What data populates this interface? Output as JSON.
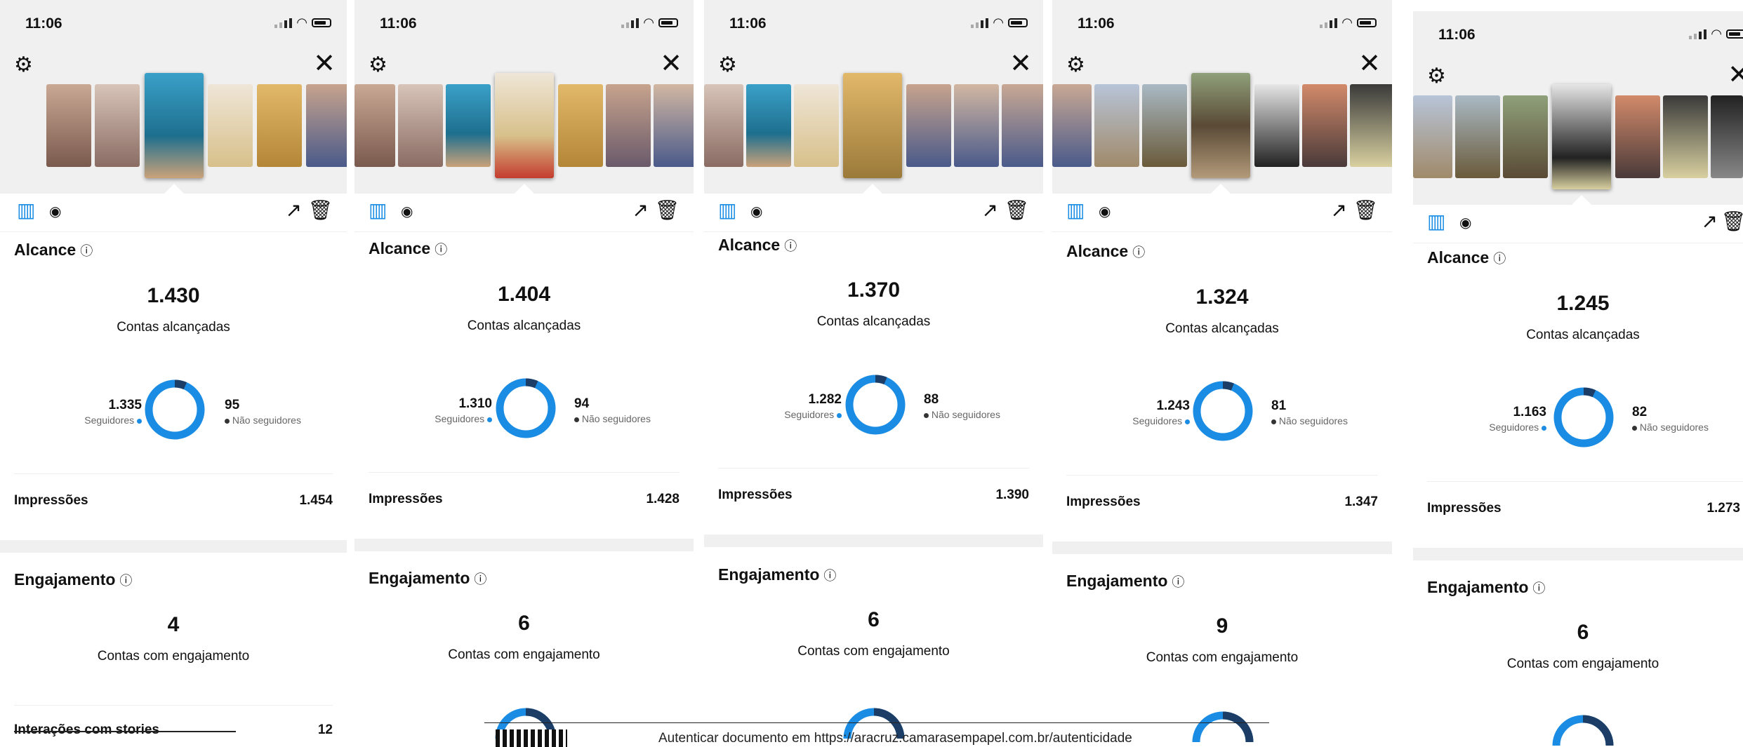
{
  "panels": [
    {
      "time": "11:06",
      "reach": {
        "title": "Alcance",
        "value": "1.430",
        "label": "Contas alcançadas",
        "followers": "1.335",
        "followers_label": "Seguidores",
        "nonfollowers": "95",
        "nonfollowers_label": "Não seguidores",
        "follower_fraction": 0.934
      },
      "impressions": {
        "label": "Impressões",
        "value": "1.454"
      },
      "engagement": {
        "title": "Engajamento",
        "value": "4",
        "label": "Contas com engajamento"
      },
      "interactions": {
        "label": "Interações com stories",
        "value": "12"
      }
    },
    {
      "time": "11:06",
      "reach": {
        "title": "Alcance",
        "value": "1.404",
        "label": "Contas alcançadas",
        "followers": "1.310",
        "followers_label": "Seguidores",
        "nonfollowers": "94",
        "nonfollowers_label": "Não seguidores",
        "follower_fraction": 0.933
      },
      "impressions": {
        "label": "Impressões",
        "value": "1.428"
      },
      "engagement": {
        "title": "Engajamento",
        "value": "6",
        "label": "Contas com engajamento"
      },
      "interactions": {
        "label": "",
        "value": ""
      }
    },
    {
      "time": "11:06",
      "reach": {
        "title": "Alcance",
        "value": "1.370",
        "label": "Contas alcançadas",
        "followers": "1.282",
        "followers_label": "Seguidores",
        "nonfollowers": "88",
        "nonfollowers_label": "Não seguidores",
        "follower_fraction": 0.936
      },
      "impressions": {
        "label": "Impressões",
        "value": "1.390"
      },
      "engagement": {
        "title": "Engajamento",
        "value": "6",
        "label": "Contas com engajamento"
      },
      "interactions": {
        "label": "",
        "value": ""
      }
    },
    {
      "time": "11:06",
      "reach": {
        "title": "Alcance",
        "value": "1.324",
        "label": "Contas alcançadas",
        "followers": "1.243",
        "followers_label": "Seguidores",
        "nonfollowers": "81",
        "nonfollowers_label": "Não seguidores",
        "follower_fraction": 0.939
      },
      "impressions": {
        "label": "Impressões",
        "value": "1.347"
      },
      "engagement": {
        "title": "Engajamento",
        "value": "9",
        "label": "Contas com engajamento"
      },
      "interactions": {
        "label": "",
        "value": ""
      }
    },
    {
      "time": "11:06",
      "reach": {
        "title": "Alcance",
        "value": "1.245",
        "label": "Contas alcançadas",
        "followers": "1.163",
        "followers_label": "Seguidores",
        "nonfollowers": "82",
        "nonfollowers_label": "Não seguidores",
        "follower_fraction": 0.934
      },
      "impressions": {
        "label": "Impressões",
        "value": "1.273"
      },
      "engagement": {
        "title": "Engajamento",
        "value": "6",
        "label": "Contas com engajamento"
      },
      "interactions": {
        "label": "",
        "value": ""
      }
    }
  ],
  "icons": {
    "gear": "gear-icon",
    "close": "close-icon",
    "chart": "bar-chart-icon",
    "eye": "eye-icon",
    "trend": "trend-icon",
    "trash": "trash-icon",
    "info": "info-icon"
  },
  "colors": {
    "primary": "#1a8ce4",
    "dark": "#1b3d66",
    "background": "#f0f0f0"
  },
  "footer": {
    "text": "Autenticar documento em https://aracruz.camarasempapel.com.br/autenticidade"
  }
}
